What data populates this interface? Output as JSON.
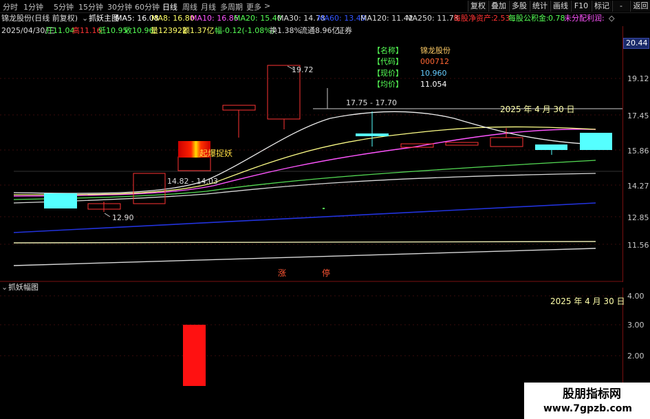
{
  "topbar": {
    "periods": [
      "分时",
      "1分钟",
      "5分钟",
      "15分钟",
      "30分钟",
      "60分钟",
      "日线",
      "周线",
      "月线",
      "多周期",
      "更多"
    ],
    "more_arrow": ">",
    "right_buttons": [
      "复权",
      "叠加",
      "多股",
      "统计",
      "画线",
      "F10",
      "标记",
      "-",
      "返回"
    ]
  },
  "header": {
    "stock_title": "锦龙股份(日线 前复权)",
    "indicator_name": "抓妖主图",
    "ma": [
      {
        "label": "MA5: 16.08",
        "color": "#ffffff"
      },
      {
        "label": "MA8: 16.80",
        "color": "#ffff66"
      },
      {
        "label": "MA10: 16.86",
        "color": "#ff55ff"
      },
      {
        "label": "MA20: 15.40",
        "color": "#55ff55"
      },
      {
        "label": "MA30: 14.78",
        "color": "#dddddd"
      },
      {
        "label": "MA60: 13.49",
        "color": "#3355ff"
      },
      {
        "label": "MA120: 11.42",
        "color": "#dddddd"
      },
      {
        "label": "MA250: 11.73",
        "color": "#dddddd"
      }
    ],
    "fin": [
      {
        "label": "每股净资产:",
        "value": "2.53",
        "color": "#ff3333"
      },
      {
        "label": "每股公积金:",
        "value": "0.78",
        "color": "#55ff55"
      },
      {
        "label": "未分配利润:",
        "value": "",
        "color": "#ff55ff"
      }
    ],
    "fin_tail": "◇",
    "date": "2025/04/30/三",
    "open": "开11.04",
    "high": "高11.16",
    "low": "低10.95",
    "close": "收10.96",
    "volume": "量123922",
    "amount": "额1.37亿",
    "change": "幅-0.12(-1.08%)",
    "turnover": "换1.38%",
    "float": "流通8.96亿",
    "sector": "证券"
  },
  "info_box": {
    "rows": [
      {
        "key": "【名称】",
        "value": "锦龙股份",
        "color": "#ffcc66"
      },
      {
        "key": "【代码】",
        "value": "000712",
        "color": "#ff6633"
      },
      {
        "key": "【现价】",
        "value": "10.960",
        "color": "#66ccff"
      },
      {
        "key": "【均价】",
        "value": "11.054",
        "color": "#ffffff"
      }
    ]
  },
  "price_axis": {
    "current": "20.44",
    "ticks": [
      "19.12",
      "17.45",
      "15.86",
      "14.27",
      "12.85",
      "11.56"
    ]
  },
  "annotations": {
    "high_1972": "19.72",
    "range_1482": "14.82 - 14.03",
    "low_1290": "12.90",
    "range_1775": "17.75 - 17.70",
    "date_main": "2025 年 4 月 30 日",
    "badge": "起爆捉妖",
    "zhang": "涨",
    "ting": "停"
  },
  "sub_chart": {
    "title": "抓妖幅图",
    "date": "2025 年 4 月 30 日",
    "ticks": [
      "4.00",
      "3.00",
      "2.00"
    ]
  },
  "colors": {
    "up": "#ff3333",
    "down": "#55ffff",
    "axis": "#7a1010"
  },
  "watermark": {
    "line1": "股朋指标网",
    "line2": "www.7gpzb.com"
  }
}
